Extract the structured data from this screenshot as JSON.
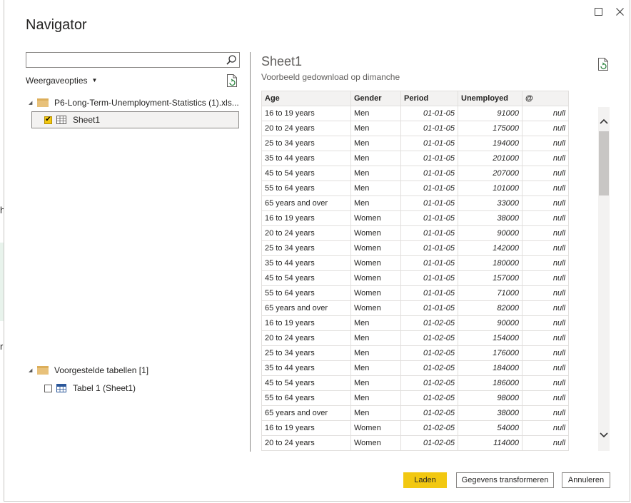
{
  "background": {
    "chars": [
      "h",
      "r"
    ]
  },
  "window": {
    "title": "Navigator",
    "maximize_icon": "maximize-icon",
    "close_icon": "close-icon"
  },
  "left": {
    "search": {
      "value": "",
      "placeholder": ""
    },
    "view_options": "Weergaveopties",
    "tree": {
      "file": {
        "label": "P6-Long-Term-Unemployment-Statistics (1).xls..."
      },
      "sheet": {
        "label": "Sheet1",
        "checked": true
      },
      "suggested": {
        "label": "Voorgestelde tabellen [1]"
      },
      "table1": {
        "label": "Tabel 1 (Sheet1)",
        "checked": false
      }
    }
  },
  "preview": {
    "title": "Sheet1",
    "subtitle": "Voorbeeld gedownload op dimanche",
    "columns": [
      "Age",
      "Gender",
      "Period",
      "Unemployed",
      "@"
    ],
    "rows": [
      [
        "16 to 19 years",
        "Men",
        "01-01-05",
        "91000",
        "null"
      ],
      [
        "20 to 24 years",
        "Men",
        "01-01-05",
        "175000",
        "null"
      ],
      [
        "25 to 34 years",
        "Men",
        "01-01-05",
        "194000",
        "null"
      ],
      [
        "35 to 44 years",
        "Men",
        "01-01-05",
        "201000",
        "null"
      ],
      [
        "45 to 54 years",
        "Men",
        "01-01-05",
        "207000",
        "null"
      ],
      [
        "55 to 64 years",
        "Men",
        "01-01-05",
        "101000",
        "null"
      ],
      [
        "65 years and over",
        "Men",
        "01-01-05",
        "33000",
        "null"
      ],
      [
        "16 to 19 years",
        "Women",
        "01-01-05",
        "38000",
        "null"
      ],
      [
        "20 to 24 years",
        "Women",
        "01-01-05",
        "90000",
        "null"
      ],
      [
        "25 to 34 years",
        "Women",
        "01-01-05",
        "142000",
        "null"
      ],
      [
        "35 to 44 years",
        "Women",
        "01-01-05",
        "180000",
        "null"
      ],
      [
        "45 to 54 years",
        "Women",
        "01-01-05",
        "157000",
        "null"
      ],
      [
        "55 to 64 years",
        "Women",
        "01-01-05",
        "71000",
        "null"
      ],
      [
        "65 years and over",
        "Women",
        "01-01-05",
        "82000",
        "null"
      ],
      [
        "16 to 19 years",
        "Men",
        "01-02-05",
        "90000",
        "null"
      ],
      [
        "20 to 24 years",
        "Men",
        "01-02-05",
        "154000",
        "null"
      ],
      [
        "25 to 34 years",
        "Men",
        "01-02-05",
        "176000",
        "null"
      ],
      [
        "35 to 44 years",
        "Men",
        "01-02-05",
        "184000",
        "null"
      ],
      [
        "45 to 54 years",
        "Men",
        "01-02-05",
        "186000",
        "null"
      ],
      [
        "55 to 64 years",
        "Men",
        "01-02-05",
        "98000",
        "null"
      ],
      [
        "65 years and over",
        "Men",
        "01-02-05",
        "38000",
        "null"
      ],
      [
        "16 to 19 years",
        "Women",
        "01-02-05",
        "54000",
        "null"
      ],
      [
        "20 to 24 years",
        "Women",
        "01-02-05",
        "114000",
        "null"
      ]
    ]
  },
  "footer": {
    "load": "Laden",
    "transform": "Gegevens transformeren",
    "cancel": "Annuleren"
  },
  "colors": {
    "accent": "#f2c811",
    "folder": "#e8c17a",
    "border": "#8a8886"
  }
}
